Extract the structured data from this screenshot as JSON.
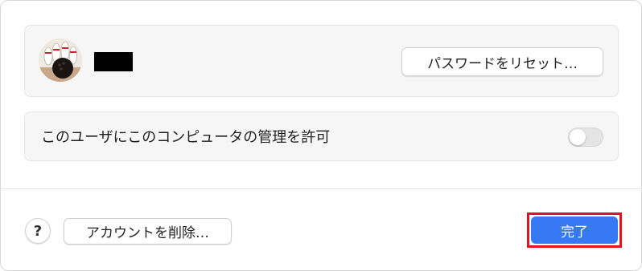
{
  "user_panel": {
    "reset_password_label": "パスワードをリセット…"
  },
  "admin_panel": {
    "allow_admin_label": "このユーザにこのコンピュータの管理を許可",
    "allow_admin_enabled": false
  },
  "footer": {
    "help_label": "?",
    "delete_account_label": "アカウントを削除…",
    "done_label": "完了"
  },
  "colors": {
    "accent": "#3778f5",
    "highlight": "#e0141e",
    "redaction": "#000000"
  }
}
